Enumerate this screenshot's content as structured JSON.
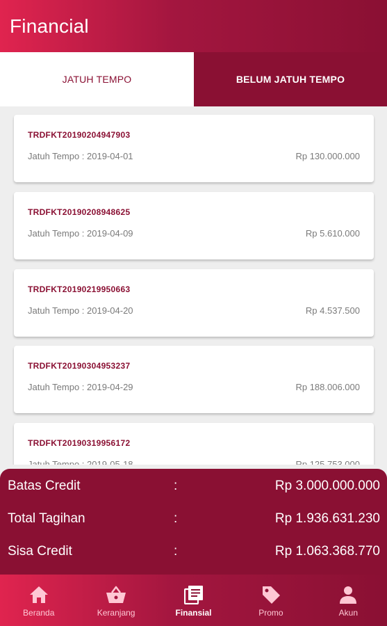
{
  "app": {
    "title": "Financial"
  },
  "tabs": [
    {
      "label": "JATUH TEMPO"
    },
    {
      "label": "BELUM JATUH TEMPO"
    }
  ],
  "invoices": [
    {
      "id": "TRDFKT20190204947903",
      "due": "Jatuh Tempo : 2019-04-01",
      "amount": "Rp 130.000.000"
    },
    {
      "id": "TRDFKT20190208948625",
      "due": "Jatuh Tempo : 2019-04-09",
      "amount": "Rp 5.610.000"
    },
    {
      "id": "TRDFKT20190219950663",
      "due": "Jatuh Tempo : 2019-04-20",
      "amount": "Rp 4.537.500"
    },
    {
      "id": "TRDFKT20190304953237",
      "due": "Jatuh Tempo : 2019-04-29",
      "amount": "Rp 188.006.000"
    },
    {
      "id": "TRDFKT20190319956172",
      "due": "Jatuh Tempo : 2019-05-18",
      "amount": "Rp 125.753.000"
    }
  ],
  "summary": {
    "separator": ":",
    "rows": [
      {
        "label": "Batas Credit",
        "value": "Rp 3.000.000.000"
      },
      {
        "label": "Total Tagihan",
        "value": "Rp 1.936.631.230"
      },
      {
        "label": "Sisa Credit",
        "value": "Rp 1.063.368.770"
      }
    ]
  },
  "nav": [
    {
      "label": "Beranda",
      "icon": "home-icon"
    },
    {
      "label": "Keranjang",
      "icon": "basket-icon"
    },
    {
      "label": "Finansial",
      "icon": "document-list-icon",
      "active": true
    },
    {
      "label": "Promo",
      "icon": "tag-icon"
    },
    {
      "label": "Akun",
      "icon": "person-icon"
    }
  ],
  "colors": {
    "primary": "#8a1033",
    "accent": "#e0244f",
    "text_muted": "#7a7a7a",
    "background": "#eeeeee"
  }
}
